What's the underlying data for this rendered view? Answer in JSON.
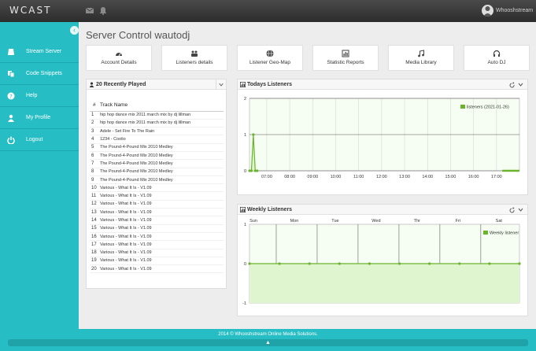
{
  "app": {
    "logo": "WCAST",
    "user_name": "Whooshstream"
  },
  "sidebar": {
    "items": [
      {
        "label": "Stream Server",
        "icon": "drive-icon"
      },
      {
        "label": "Code Snippets",
        "icon": "copy-icon"
      },
      {
        "label": "Help",
        "icon": "question-icon"
      },
      {
        "label": "My Profile",
        "icon": "user-icon"
      },
      {
        "label": "Logout",
        "icon": "power-icon"
      }
    ]
  },
  "page": {
    "title": "Server Control wautodj"
  },
  "quick_links": [
    {
      "label": "Account Details",
      "icon": "dashboard-icon"
    },
    {
      "label": "Listeners details",
      "icon": "group-icon"
    },
    {
      "label": "Listener Geo-Map",
      "icon": "globe-icon"
    },
    {
      "label": "Statistic Reports",
      "icon": "bar-chart-icon"
    },
    {
      "label": "Media Library",
      "icon": "music-icon"
    },
    {
      "label": "Auto DJ",
      "icon": "headphones-icon"
    }
  ],
  "recent": {
    "title": "20 Recently Played",
    "col_num": "#",
    "col_track": "Track Name",
    "rows": [
      {
        "n": "1",
        "track": "hip hop dance mix 2011 march mix by dj lillman"
      },
      {
        "n": "2",
        "track": "hip hop dance mix 2011 march mix by dj lillman"
      },
      {
        "n": "3",
        "track": "Adele - Set Fire To The Rain"
      },
      {
        "n": "4",
        "track": "1234 - Coolio"
      },
      {
        "n": "5",
        "track": "The Pound-4-Pound Mix 2010 Medley"
      },
      {
        "n": "6",
        "track": "The Pound-4-Pound Mix 2010 Medley"
      },
      {
        "n": "7",
        "track": "The Pound-4-Pound Mix 2010 Medley"
      },
      {
        "n": "8",
        "track": "The Pound-4-Pound Mix 2010 Medley"
      },
      {
        "n": "9",
        "track": "The Pound-4-Pound Mix 2010 Medley"
      },
      {
        "n": "10",
        "track": "Various - What It Is - V1.09"
      },
      {
        "n": "11",
        "track": "Various - What It Is - V1.09"
      },
      {
        "n": "12",
        "track": "Various - What It Is - V1.09"
      },
      {
        "n": "13",
        "track": "Various - What It Is - V1.09"
      },
      {
        "n": "14",
        "track": "Various - What It Is - V1.09"
      },
      {
        "n": "15",
        "track": "Various - What It Is - V1.09"
      },
      {
        "n": "16",
        "track": "Various - What It Is - V1.09"
      },
      {
        "n": "17",
        "track": "Various - What It Is - V1.09"
      },
      {
        "n": "18",
        "track": "Various - What It Is - V1.09"
      },
      {
        "n": "19",
        "track": "Various - What It Is - V1.09"
      },
      {
        "n": "20",
        "track": "Various - What It Is - V1.09"
      }
    ]
  },
  "chart_data": [
    {
      "type": "line",
      "title": "Todays Listeners",
      "series": [
        {
          "name": "listeners (2021-01-26)",
          "x": [
            "06:15",
            "06:20",
            "06:25",
            "06:30",
            "06:35",
            "17:15",
            "17:30",
            "17:45",
            "18:00"
          ],
          "values": [
            0,
            0,
            1,
            0,
            0,
            0,
            0,
            0,
            0
          ]
        }
      ],
      "x_ticks": [
        "07:00",
        "08:00",
        "09:00",
        "10:00",
        "11:00",
        "12:00",
        "13:00",
        "14:00",
        "15:00",
        "16:00",
        "17:00"
      ],
      "y_ticks": [
        "0",
        "1",
        "2"
      ],
      "ylim": [
        0,
        2
      ],
      "xlim": [
        "06:15",
        "18:00"
      ],
      "legend": "top-right",
      "color": "#6ab42d"
    },
    {
      "type": "line",
      "title": "Weekly Listeners",
      "series": [
        {
          "name": "Weekly listener",
          "x": [
            "Sat",
            "Sun",
            "Mon",
            "Mon",
            "Tue",
            "Wed",
            "Thr",
            "Thr",
            "Fri",
            "Sat"
          ],
          "values": [
            0,
            0,
            0,
            0,
            0,
            0,
            0,
            0,
            0,
            0
          ]
        }
      ],
      "x_ticks": [
        "Sun",
        "Mon",
        "Tue",
        "Wed",
        "Thr",
        "Fri",
        "Sat"
      ],
      "y_ticks": [
        "-1",
        "0",
        "1"
      ],
      "ylim": [
        -1,
        1
      ],
      "legend": "top-right",
      "color": "#6ab42d"
    }
  ],
  "footer": {
    "text": "2014 © Whooshstream Online Media Solutions."
  }
}
